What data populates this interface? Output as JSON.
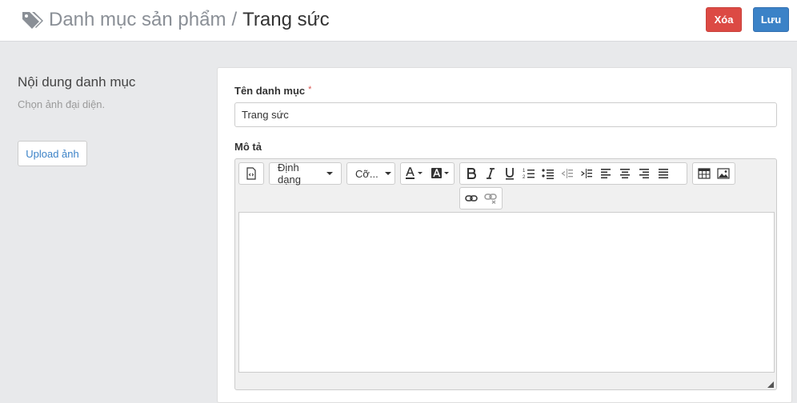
{
  "header": {
    "icon": "tags-icon",
    "breadcrumb_parent": "Danh mục sản phẩm",
    "separator": "/",
    "current": "Trang sức",
    "delete_label": "Xóa",
    "save_label": "Lưu",
    "colors": {
      "delete": "#dc4a44",
      "save": "#3b82c7"
    }
  },
  "sidebar": {
    "title": "Nội dung danh mục",
    "hint": "Chọn ảnh đại diện.",
    "upload_label": "Upload ảnh"
  },
  "form": {
    "name_label": "Tên danh mục",
    "required_mark": "*",
    "name_value": "Trang sức",
    "desc_label": "Mô tả"
  },
  "editor": {
    "toolbar": {
      "code_view_icon": "code-view-icon",
      "format_dropdown": "Định dạng",
      "size_dropdown": "Cỡ...",
      "font_color_icon": "font-color-icon",
      "background_color_icon": "background-color-icon",
      "bold_icon": "bold-icon",
      "italic_icon": "italic-icon",
      "underline_icon": "underline-icon",
      "ordered_list_icon": "ordered-list-icon",
      "unordered_list_icon": "unordered-list-icon",
      "outdent_icon": "outdent-icon",
      "indent_icon": "indent-icon",
      "align_left_icon": "align-left-icon",
      "align_center_icon": "align-center-icon",
      "align_right_icon": "align-right-icon",
      "justify_icon": "justify-icon",
      "table_icon": "table-icon",
      "image_icon": "image-icon",
      "link_icon": "link-icon",
      "unlink_icon": "unlink-icon"
    },
    "content": ""
  }
}
